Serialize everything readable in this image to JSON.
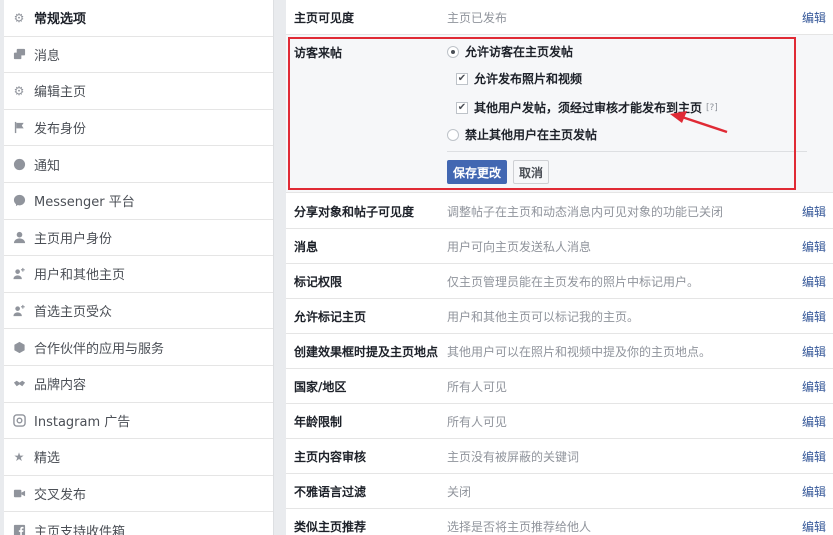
{
  "sidebar": {
    "items": [
      {
        "label": "常规选项",
        "icon": "gear-icon",
        "active": true
      },
      {
        "label": "消息",
        "icon": "chat-icon"
      },
      {
        "label": "编辑主页",
        "icon": "gear-icon"
      },
      {
        "label": "发布身份",
        "icon": "flag-icon"
      },
      {
        "label": "通知",
        "icon": "globe-icon"
      },
      {
        "label": "Messenger 平台",
        "icon": "messenger-icon"
      },
      {
        "label": "主页用户身份",
        "icon": "person-icon"
      },
      {
        "label": "用户和其他主页",
        "icon": "people-icon"
      },
      {
        "label": "首选主页受众",
        "icon": "people-icon"
      },
      {
        "label": "合作伙伴的应用与服务",
        "icon": "cube-icon"
      },
      {
        "label": "品牌内容",
        "icon": "handshake-icon"
      },
      {
        "label": "Instagram 广告",
        "icon": "instagram-icon"
      },
      {
        "label": "精选",
        "icon": "star-icon"
      },
      {
        "label": "交叉发布",
        "icon": "video-icon"
      },
      {
        "label": "主页支持收件箱",
        "icon": "facebook-icon"
      }
    ]
  },
  "main": {
    "edit_label": "编辑",
    "top_row": {
      "label": "主页可见度",
      "desc": "主页已发布"
    },
    "visitor_posts": {
      "label": "访客来帖",
      "opt_allow": "允许访客在主页发帖",
      "opt_photos": "允许发布照片和视频",
      "opt_review": "其他用户发帖，须经过审核才能发布到主页",
      "help": "[?]",
      "opt_disable": "禁止其他用户在主页发帖",
      "save": "保存更改",
      "cancel": "取消"
    },
    "rows": [
      {
        "label": "分享对象和帖子可见度",
        "desc": "调整帖子在主页和动态消息内可见对象的功能已关闭"
      },
      {
        "label": "消息",
        "desc": "用户可向主页发送私人消息"
      },
      {
        "label": "标记权限",
        "desc": "仅主页管理员能在主页发布的照片中标记用户。"
      },
      {
        "label": "允许标记主页",
        "desc": "用户和其他主页可以标记我的主页。"
      },
      {
        "label": "创建效果框时提及主页地点",
        "desc": "其他用户可以在照片和视频中提及你的主页地点。"
      },
      {
        "label": "国家/地区",
        "desc": "所有人可见"
      },
      {
        "label": "年龄限制",
        "desc": "所有人可见"
      },
      {
        "label": "主页内容审核",
        "desc": "主页没有被屏蔽的关键词"
      },
      {
        "label": "不雅语言过滤",
        "desc": "关闭"
      },
      {
        "label": "类似主页推荐",
        "desc": "选择是否将主页推荐给他人"
      }
    ]
  },
  "colors": {
    "accent": "#4267b2",
    "link": "#365899",
    "annotation": "#e02a35"
  }
}
